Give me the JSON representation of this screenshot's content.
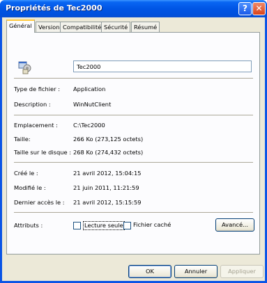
{
  "window": {
    "title": "Propriétés de Tec2000"
  },
  "title_buttons": {
    "help": "?",
    "close": "✕"
  },
  "tabs": [
    {
      "label": "Général"
    },
    {
      "label": "Version"
    },
    {
      "label": "Compatibilité"
    },
    {
      "label": "Sécurité"
    },
    {
      "label": "Résumé"
    }
  ],
  "file_name": "Tec2000",
  "info": {
    "type_label": "Type de fichier :",
    "type_value": "Application",
    "desc_label": "Description :",
    "desc_value": "WinNutClient",
    "location_label": "Emplacement :",
    "location_value": "C:\\Tec2000",
    "size_label": "Taille:",
    "size_value": "266 Ko (273,125 octets)",
    "disk_label": "Taille sur le disque :",
    "disk_value": "268 Ko (274,432 octets)",
    "created_label": "Créé le :",
    "created_value": "21 avril 2012, 15:04:15",
    "modified_label": "Modifié le :",
    "modified_value": "21 juin 2011, 11:21:59",
    "accessed_label": "Dernier accès le :",
    "accessed_value": "21 avril 2012, 15:15:59"
  },
  "attributes": {
    "label": "Attributs :",
    "readonly": "Lecture seule",
    "hidden": "Fichier caché",
    "advanced": "Avancé..."
  },
  "buttons": {
    "ok": "OK",
    "cancel": "Annuler",
    "apply": "Appliquer"
  },
  "colors": {
    "titlebar": "#0055e5",
    "dialog_bg": "#ece9d8",
    "tab_highlight": "#ffc83c"
  }
}
